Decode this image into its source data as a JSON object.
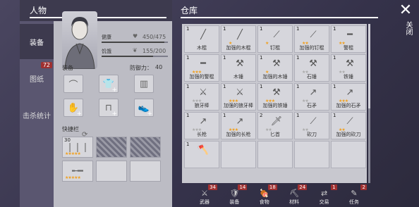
{
  "character": {
    "title": "人物",
    "tabs": [
      {
        "label": "装备",
        "active": true
      },
      {
        "label": "图纸",
        "badge": "72"
      },
      {
        "label": "击杀统计"
      }
    ],
    "stats": [
      {
        "label": "健康",
        "value": "450/475",
        "icon": "heart-icon",
        "fill": 0.95
      },
      {
        "label": "饥饿",
        "value": "155/200",
        "icon": "stomach-icon",
        "fill": 0.775
      }
    ],
    "equipment_label": "装备",
    "defense_label": "防御力：",
    "defense_value": "40",
    "equipment_slots": [
      "hat-icon",
      "shirt-icon",
      "vest-icon",
      "gloves-icon",
      "pants-icon",
      "shoes-icon"
    ],
    "quick_label": "快捷栏",
    "quick_slots": [
      {
        "count": "30",
        "icon": "bullets-icon",
        "stars": "★★★★★"
      },
      {
        "count": "",
        "icon": "empty",
        "hatched": true
      },
      {
        "count": "",
        "icon": "empty",
        "hatched": true
      },
      {
        "count": "",
        "icon": "rifle-icon",
        "stars": "★★★★★"
      },
      {
        "count": "",
        "icon": "empty"
      },
      {
        "count": "",
        "icon": "empty"
      }
    ]
  },
  "warehouse": {
    "title": "仓库",
    "items": [
      {
        "count": "1",
        "name": "木棍",
        "stars": "",
        "gold": false,
        "icon": "stick-icon"
      },
      {
        "count": "1",
        "name": "加强的木棍",
        "stars": "★",
        "gold": true,
        "icon": "stick-icon"
      },
      {
        "count": "1",
        "name": "钉棍",
        "stars": "★",
        "gold": true,
        "icon": "club-icon"
      },
      {
        "count": "1",
        "name": "加强的钉棍",
        "stars": "★★",
        "gold": true,
        "icon": "club-icon"
      },
      {
        "count": "1",
        "name": "警棍",
        "stars": "★★",
        "gold": true,
        "icon": "baton-icon"
      },
      {
        "count": "1",
        "name": "加强的警棍",
        "stars": "★★★",
        "gold": true,
        "icon": "baton-icon"
      },
      {
        "count": "1",
        "name": "木锤",
        "stars": "",
        "gold": false,
        "icon": "hammer-icon"
      },
      {
        "count": "1",
        "name": "加强的木锤",
        "stars": "★",
        "gold": true,
        "icon": "hammer-icon"
      },
      {
        "count": "1",
        "name": "石锤",
        "stars": "★★",
        "gold": false,
        "icon": "hammer-icon"
      },
      {
        "count": "1",
        "name": "铁锤",
        "stars": "★★",
        "gold": false,
        "icon": "hammer-icon"
      },
      {
        "count": "1",
        "name": "狼牙棒",
        "stars": "★★★",
        "gold": false,
        "icon": "mace-icon"
      },
      {
        "count": "1",
        "name": "加强的狼牙棒",
        "stars": "★★★",
        "gold": true,
        "icon": "mace-icon"
      },
      {
        "count": "1",
        "name": "加强的铁锤",
        "stars": "★★★",
        "gold": true,
        "icon": "hammer-icon"
      },
      {
        "count": "1",
        "name": "石矛",
        "stars": "★★",
        "gold": false,
        "icon": "spear-icon"
      },
      {
        "count": "1",
        "name": "加强的石矛",
        "stars": "★★★",
        "gold": true,
        "icon": "spear-icon"
      },
      {
        "count": "1",
        "name": "长枪",
        "stars": "★★★",
        "gold": false,
        "icon": "spear-icon"
      },
      {
        "count": "1",
        "name": "加强的长枪",
        "stars": "★★★",
        "gold": true,
        "icon": "spear-icon"
      },
      {
        "count": "2",
        "name": "匕首",
        "stars": "★★",
        "gold": false,
        "icon": "dagger-icon"
      },
      {
        "count": "1",
        "name": "砍刀",
        "stars": "★★",
        "gold": false,
        "icon": "machete-icon"
      },
      {
        "count": "1",
        "name": "加强的砍刀",
        "stars": "★★",
        "gold": true,
        "icon": "machete-icon"
      },
      {
        "count": "1",
        "name": "",
        "stars": "",
        "gold": false,
        "icon": "axe-icon"
      },
      {
        "count": "",
        "name": "",
        "stars": "",
        "gold": false,
        "icon": "empty"
      },
      {
        "count": "",
        "name": "",
        "stars": "",
        "gold": false,
        "icon": "empty"
      },
      {
        "count": "",
        "name": "",
        "stars": "",
        "gold": false,
        "icon": "empty"
      },
      {
        "count": "",
        "name": "",
        "stars": "",
        "gold": false,
        "icon": "empty"
      }
    ],
    "categories": [
      {
        "label": "武器",
        "badge": "34",
        "icon": "weapon-icon"
      },
      {
        "label": "装备",
        "badge": "14",
        "icon": "armor-icon"
      },
      {
        "label": "食物",
        "badge": "18",
        "icon": "food-icon"
      },
      {
        "label": "材料",
        "badge": "24",
        "icon": "material-icon"
      },
      {
        "label": "交易",
        "badge": "1",
        "icon": "trade-icon"
      },
      {
        "label": "任务",
        "badge": "2",
        "icon": "quest-icon"
      }
    ]
  },
  "close": {
    "icon": "close-icon",
    "label": "关闭"
  }
}
